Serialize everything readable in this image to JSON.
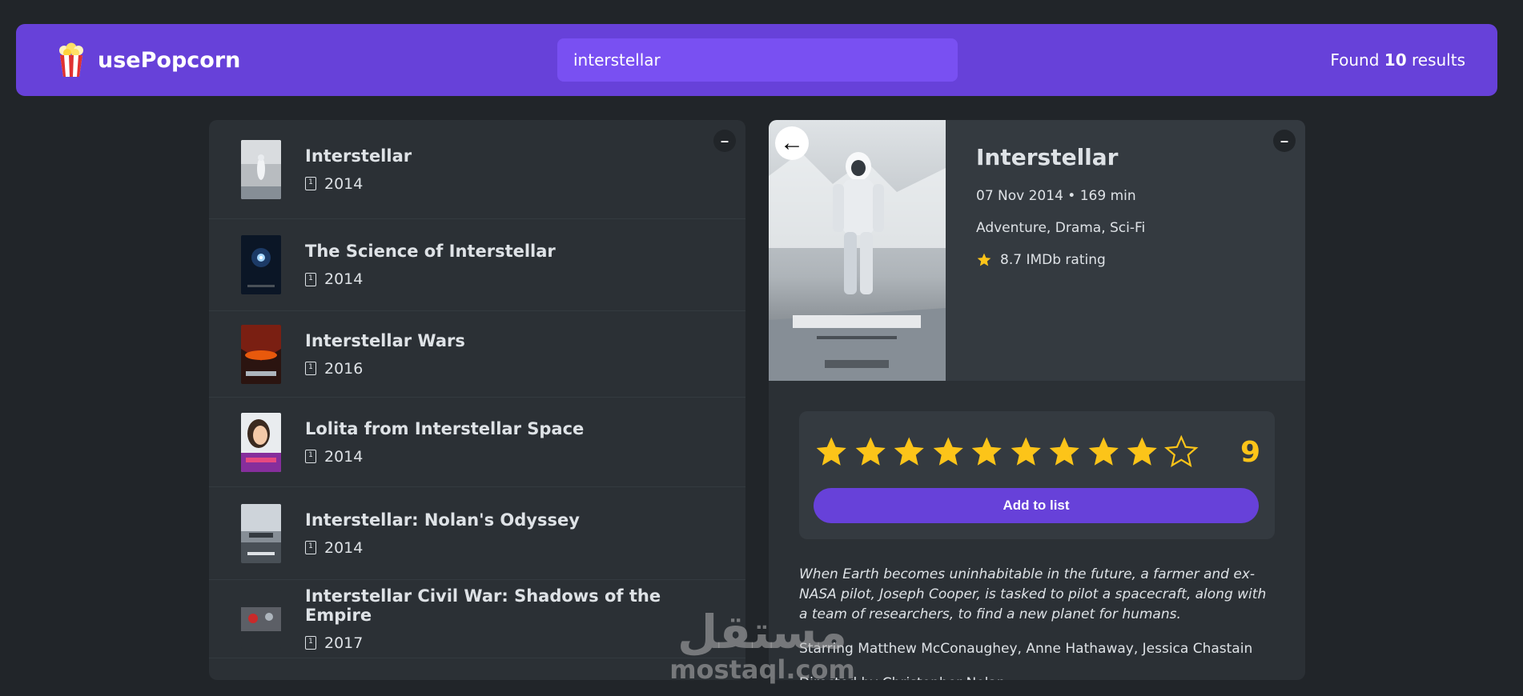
{
  "nav": {
    "logo_text": "usePopcorn",
    "search_value": "interstellar",
    "results_prefix": "Found",
    "results_count": "10",
    "results_suffix": "results"
  },
  "list": {
    "toggle_label": "–",
    "items": [
      {
        "title": "Interstellar",
        "year": "2014"
      },
      {
        "title": "The Science of Interstellar",
        "year": "2014"
      },
      {
        "title": "Interstellar Wars",
        "year": "2016"
      },
      {
        "title": "Lolita from Interstellar Space",
        "year": "2014"
      },
      {
        "title": "Interstellar: Nolan's Odyssey",
        "year": "2014"
      },
      {
        "title": "Interstellar Civil War: Shadows of the Empire",
        "year": "2017"
      }
    ]
  },
  "details": {
    "toggle_label": "–",
    "back_label": "←",
    "title": "Interstellar",
    "released_runtime": "07 Nov 2014 • 169 min",
    "genre": "Adventure, Drama, Sci-Fi",
    "imdb_rating": "8.7 IMDb rating",
    "user_rating": "9",
    "max_rating": 10,
    "add_button": "Add to list",
    "plot": "When Earth becomes uninhabitable in the future, a farmer and ex-NASA pilot, Joseph Cooper, is tasked to pilot a spacecraft, along with a team of researchers, to find a new planet for humans.",
    "starring": "Starring Matthew McConaughey, Anne Hathaway, Jessica Chastain",
    "directed": "Directed by Christopher Nolan"
  },
  "watermark": {
    "arabic": "مستقل",
    "latin": "mostaql.com"
  },
  "colors": {
    "primary": "#6741d9",
    "primary_light": "#7950f2",
    "background": "#212529",
    "box": "#2b3035",
    "star": "#fcc419"
  }
}
